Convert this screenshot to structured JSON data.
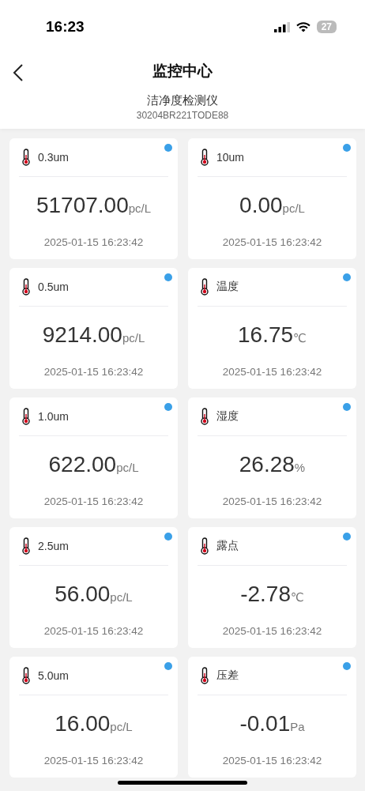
{
  "status_bar": {
    "time": "16:23",
    "battery": "27"
  },
  "nav": {
    "title": "监控中心"
  },
  "device": {
    "name": "洁净度检测仪",
    "serial": "30204BR221TODE88"
  },
  "sensors": [
    {
      "label": "0.3um",
      "value": "51707.00",
      "unit": "pc/L",
      "time": "2025-01-15 16:23:42",
      "online": true
    },
    {
      "label": "10um",
      "value": "0.00",
      "unit": "pc/L",
      "time": "2025-01-15 16:23:42",
      "online": true
    },
    {
      "label": "0.5um",
      "value": "9214.00",
      "unit": "pc/L",
      "time": "2025-01-15 16:23:42",
      "online": true
    },
    {
      "label": "温度",
      "value": "16.75",
      "unit": "℃",
      "time": "2025-01-15 16:23:42",
      "online": true
    },
    {
      "label": "1.0um",
      "value": "622.00",
      "unit": "pc/L",
      "time": "2025-01-15 16:23:42",
      "online": true
    },
    {
      "label": "湿度",
      "value": "26.28",
      "unit": "%",
      "time": "2025-01-15 16:23:42",
      "online": true
    },
    {
      "label": "2.5um",
      "value": "56.00",
      "unit": "pc/L",
      "time": "2025-01-15 16:23:42",
      "online": true
    },
    {
      "label": "露点",
      "value": "-2.78",
      "unit": "℃",
      "time": "2025-01-15 16:23:42",
      "online": true
    },
    {
      "label": "5.0um",
      "value": "16.00",
      "unit": "pc/L",
      "time": "2025-01-15 16:23:42",
      "online": true
    },
    {
      "label": "压差",
      "value": "-0.01",
      "unit": "Pa",
      "time": "2025-01-15 16:23:42",
      "online": true
    }
  ]
}
